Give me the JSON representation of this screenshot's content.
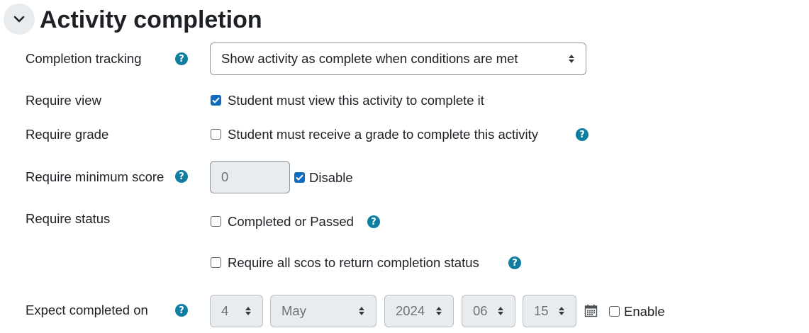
{
  "section": {
    "title": "Activity completion",
    "collapse_icon": "chevron-down-icon"
  },
  "completion_tracking": {
    "label": "Completion tracking",
    "selected": "Show activity as complete when conditions are met"
  },
  "require_view": {
    "label": "Require view",
    "checkbox_label": "Student must view this activity to complete it",
    "checked": true
  },
  "require_grade": {
    "label": "Require grade",
    "checkbox_label": "Student must receive a grade to complete this activity",
    "checked": false
  },
  "require_minimum_score": {
    "label": "Require minimum score",
    "value": "0",
    "disable_label": "Disable",
    "disable_checked": true
  },
  "require_status": {
    "label": "Require status",
    "completed_or_passed_label": "Completed or Passed",
    "completed_or_passed_checked": false,
    "all_scos_label": "Require all scos to return completion status",
    "all_scos_checked": false
  },
  "expect_completed_on": {
    "label": "Expect completed on",
    "day": "4",
    "month": "May",
    "year": "2024",
    "hour": "06",
    "minute": "15",
    "calendar_icon": "calendar-icon",
    "enable_label": "Enable",
    "enable_checked": false
  },
  "colors": {
    "help_icon": "#0f7ea0",
    "checkbox_checked": "#0f6cbf",
    "disabled_bg": "#e9ecef"
  }
}
